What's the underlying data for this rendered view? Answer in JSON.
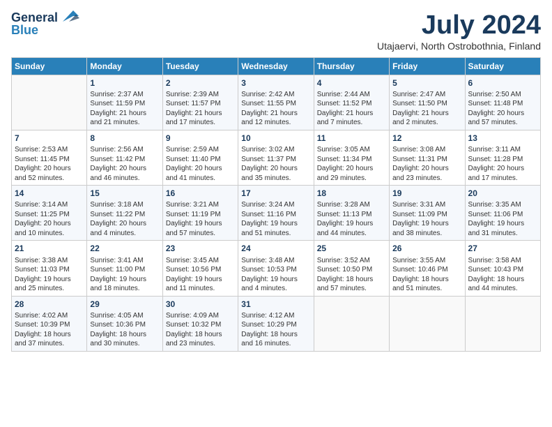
{
  "logo": {
    "line1": "General",
    "line2": "Blue"
  },
  "header": {
    "month": "July 2024",
    "location": "Utajaervi, North Ostrobothnia, Finland"
  },
  "days_of_week": [
    "Sunday",
    "Monday",
    "Tuesday",
    "Wednesday",
    "Thursday",
    "Friday",
    "Saturday"
  ],
  "weeks": [
    [
      {
        "day": "",
        "info": ""
      },
      {
        "day": "1",
        "info": "Sunrise: 2:37 AM\nSunset: 11:59 PM\nDaylight: 21 hours and 21 minutes."
      },
      {
        "day": "2",
        "info": "Sunrise: 2:39 AM\nSunset: 11:57 PM\nDaylight: 21 hours and 17 minutes."
      },
      {
        "day": "3",
        "info": "Sunrise: 2:42 AM\nSunset: 11:55 PM\nDaylight: 21 hours and 12 minutes."
      },
      {
        "day": "4",
        "info": "Sunrise: 2:44 AM\nSunset: 11:52 PM\nDaylight: 21 hours and 7 minutes."
      },
      {
        "day": "5",
        "info": "Sunrise: 2:47 AM\nSunset: 11:50 PM\nDaylight: 21 hours and 2 minutes."
      },
      {
        "day": "6",
        "info": "Sunrise: 2:50 AM\nSunset: 11:48 PM\nDaylight: 20 hours and 57 minutes."
      }
    ],
    [
      {
        "day": "7",
        "info": "Sunrise: 2:53 AM\nSunset: 11:45 PM\nDaylight: 20 hours and 52 minutes."
      },
      {
        "day": "8",
        "info": "Sunrise: 2:56 AM\nSunset: 11:42 PM\nDaylight: 20 hours and 46 minutes."
      },
      {
        "day": "9",
        "info": "Sunrise: 2:59 AM\nSunset: 11:40 PM\nDaylight: 20 hours and 41 minutes."
      },
      {
        "day": "10",
        "info": "Sunrise: 3:02 AM\nSunset: 11:37 PM\nDaylight: 20 hours and 35 minutes."
      },
      {
        "day": "11",
        "info": "Sunrise: 3:05 AM\nSunset: 11:34 PM\nDaylight: 20 hours and 29 minutes."
      },
      {
        "day": "12",
        "info": "Sunrise: 3:08 AM\nSunset: 11:31 PM\nDaylight: 20 hours and 23 minutes."
      },
      {
        "day": "13",
        "info": "Sunrise: 3:11 AM\nSunset: 11:28 PM\nDaylight: 20 hours and 17 minutes."
      }
    ],
    [
      {
        "day": "14",
        "info": "Sunrise: 3:14 AM\nSunset: 11:25 PM\nDaylight: 20 hours and 10 minutes."
      },
      {
        "day": "15",
        "info": "Sunrise: 3:18 AM\nSunset: 11:22 PM\nDaylight: 20 hours and 4 minutes."
      },
      {
        "day": "16",
        "info": "Sunrise: 3:21 AM\nSunset: 11:19 PM\nDaylight: 19 hours and 57 minutes."
      },
      {
        "day": "17",
        "info": "Sunrise: 3:24 AM\nSunset: 11:16 PM\nDaylight: 19 hours and 51 minutes."
      },
      {
        "day": "18",
        "info": "Sunrise: 3:28 AM\nSunset: 11:13 PM\nDaylight: 19 hours and 44 minutes."
      },
      {
        "day": "19",
        "info": "Sunrise: 3:31 AM\nSunset: 11:09 PM\nDaylight: 19 hours and 38 minutes."
      },
      {
        "day": "20",
        "info": "Sunrise: 3:35 AM\nSunset: 11:06 PM\nDaylight: 19 hours and 31 minutes."
      }
    ],
    [
      {
        "day": "21",
        "info": "Sunrise: 3:38 AM\nSunset: 11:03 PM\nDaylight: 19 hours and 25 minutes."
      },
      {
        "day": "22",
        "info": "Sunrise: 3:41 AM\nSunset: 11:00 PM\nDaylight: 19 hours and 18 minutes."
      },
      {
        "day": "23",
        "info": "Sunrise: 3:45 AM\nSunset: 10:56 PM\nDaylight: 19 hours and 11 minutes."
      },
      {
        "day": "24",
        "info": "Sunrise: 3:48 AM\nSunset: 10:53 PM\nDaylight: 19 hours and 4 minutes."
      },
      {
        "day": "25",
        "info": "Sunrise: 3:52 AM\nSunset: 10:50 PM\nDaylight: 18 hours and 57 minutes."
      },
      {
        "day": "26",
        "info": "Sunrise: 3:55 AM\nSunset: 10:46 PM\nDaylight: 18 hours and 51 minutes."
      },
      {
        "day": "27",
        "info": "Sunrise: 3:58 AM\nSunset: 10:43 PM\nDaylight: 18 hours and 44 minutes."
      }
    ],
    [
      {
        "day": "28",
        "info": "Sunrise: 4:02 AM\nSunset: 10:39 PM\nDaylight: 18 hours and 37 minutes."
      },
      {
        "day": "29",
        "info": "Sunrise: 4:05 AM\nSunset: 10:36 PM\nDaylight: 18 hours and 30 minutes."
      },
      {
        "day": "30",
        "info": "Sunrise: 4:09 AM\nSunset: 10:32 PM\nDaylight: 18 hours and 23 minutes."
      },
      {
        "day": "31",
        "info": "Sunrise: 4:12 AM\nSunset: 10:29 PM\nDaylight: 18 hours and 16 minutes."
      },
      {
        "day": "",
        "info": ""
      },
      {
        "day": "",
        "info": ""
      },
      {
        "day": "",
        "info": ""
      }
    ]
  ]
}
